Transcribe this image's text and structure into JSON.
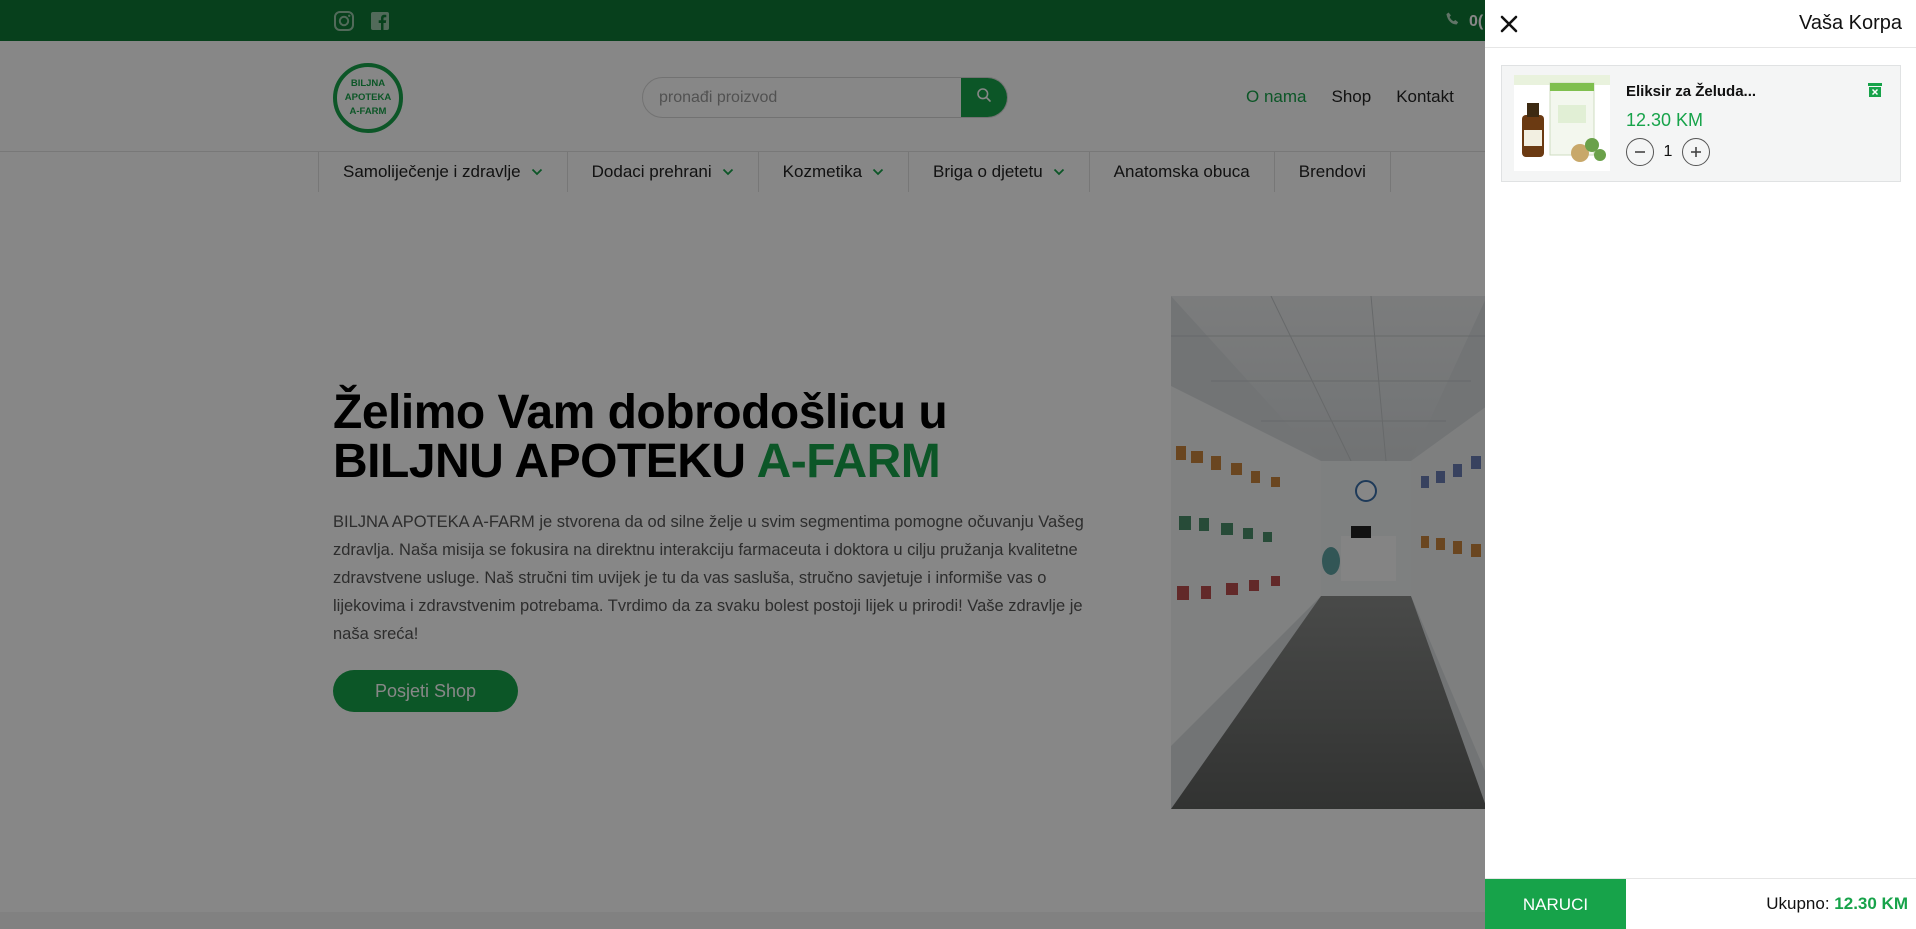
{
  "topbar": {
    "social_icons": [
      "instagram-icon",
      "facebook-icon"
    ],
    "phone_icon": "phone-icon",
    "phone_text": "0("
  },
  "header": {
    "logo_text": "BILJNA APOTEKA A-FARM",
    "search_placeholder": "pronađi proizvod",
    "nav": [
      "O nama",
      "Shop",
      "Kontakt"
    ],
    "active_nav": "O nama"
  },
  "categories": [
    {
      "label": "Samoliječenje i zdravlje",
      "has_dropdown": true
    },
    {
      "label": "Dodaci prehrani",
      "has_dropdown": true
    },
    {
      "label": "Kozmetika",
      "has_dropdown": true
    },
    {
      "label": "Briga o djetetu",
      "has_dropdown": true
    },
    {
      "label": "Anatomska obuca",
      "has_dropdown": false
    },
    {
      "label": "Brendovi",
      "has_dropdown": false
    }
  ],
  "hero": {
    "title_line1": "Želimo Vam dobrodošlicu u",
    "title_line2_part1": "BILJNU APOTEKU ",
    "title_line2_accent": "A-FARM",
    "description": "BILJNA APOTEKA A-FARM je stvorena da od silne želje u svim segmentima pomogne očuvanju Vašeg zdravlja. Naša misija se fokusira na direktnu interakciju farmaceuta i doktora u cilju pružanja kvalitetne zdravstvene usluge. Naš stručni tim uvijek je tu da vas sasluša, stručno savjetuje i informiše vas o lijekovima i zdravstvenim potrebama. Tvrdimo da za svaku bolest postoji lijek u prirodi! Vaše zdravlje je naša sreća!",
    "cta_label": "Posjeti Shop"
  },
  "cart": {
    "title": "Vaša Korpa",
    "items": [
      {
        "name": "Eliksir za Želuda...",
        "price": "12.30 KM",
        "quantity": "1"
      }
    ],
    "order_label": "NARUCI",
    "total_label": "Ukupno: ",
    "total_value": "12.30 KM"
  },
  "colors": {
    "brand_green": "#17a34a",
    "topbar_green": "#0f7a35",
    "overlay": "rgba(0,0,0,0.47)"
  }
}
